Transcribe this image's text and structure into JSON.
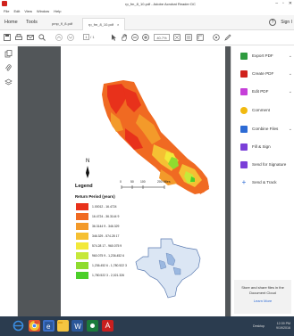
{
  "window": {
    "title": "rp_fm_8_10.pdf - Adobe Acrobat Reader DC",
    "controls": [
      "–",
      "▫",
      "✕"
    ]
  },
  "menu": [
    "File",
    "Edit",
    "View",
    "Window",
    "Help"
  ],
  "tabs": {
    "home": "Home",
    "tools": "Tools",
    "doc_tabs": [
      "pmp_fl_8.pdf",
      "rp_fm_8_10.pdf"
    ],
    "close": "×",
    "help": "?",
    "signin": "Sign I"
  },
  "toolbar": {
    "page_current": "1",
    "page_total": "/ 1",
    "zoom": "40.7%"
  },
  "document": {
    "north_label": "N",
    "legend_title": "Legend",
    "legend_subtitle": "Return Period (years)",
    "scale_ticks": [
      "0",
      "50",
      "100",
      "200 Miles"
    ],
    "legend_items": [
      {
        "label": "1.00012 - 16.4724",
        "color": "#e8311b"
      },
      {
        "label": "16.4724 - 36.3144 9",
        "color": "#f06a22"
      },
      {
        "label": "36.3144 9 - 346.329",
        "color": "#f39a2a"
      },
      {
        "label": "346.329 - 574.28 17",
        "color": "#f5c033"
      },
      {
        "label": "574.28 17 - 960.075 9",
        "color": "#f2e93a"
      },
      {
        "label": "960.075 9 - 1,236.452 6",
        "color": "#c6e83a"
      },
      {
        "label": "1,236.452 6 - 1,780.522 3",
        "color": "#8fdc2f"
      },
      {
        "label": "1,780.522 3 - 2,021.326",
        "color": "#4ccf2a"
      }
    ]
  },
  "right_panel": {
    "items": [
      {
        "label": "Export PDF",
        "color": "#2e9b3f",
        "chevron": true
      },
      {
        "label": "Create PDF",
        "color": "#d0211c",
        "chevron": true
      },
      {
        "label": "Edit PDF",
        "color": "#c53fd8",
        "chevron": true
      },
      {
        "label": "Comment",
        "color": "#f1b90f",
        "chevron": false
      },
      {
        "label": "Combine Files",
        "color": "#2d6bd5",
        "chevron": true
      },
      {
        "label": "Fill & Sign",
        "color": "#7a3fd8",
        "chevron": false
      },
      {
        "label": "Send for Signature",
        "color": "#7a3fd8",
        "chevron": false
      },
      {
        "label": "Send & Track",
        "color": "#2d6bd5",
        "chevron": false
      }
    ],
    "cloud_text": "Store and share files in the Document Cloud",
    "learn_more": "Learn More"
  },
  "taskbar": {
    "desktop": "Desktop",
    "time": "12:39 PM",
    "date": "9/19/2016"
  }
}
